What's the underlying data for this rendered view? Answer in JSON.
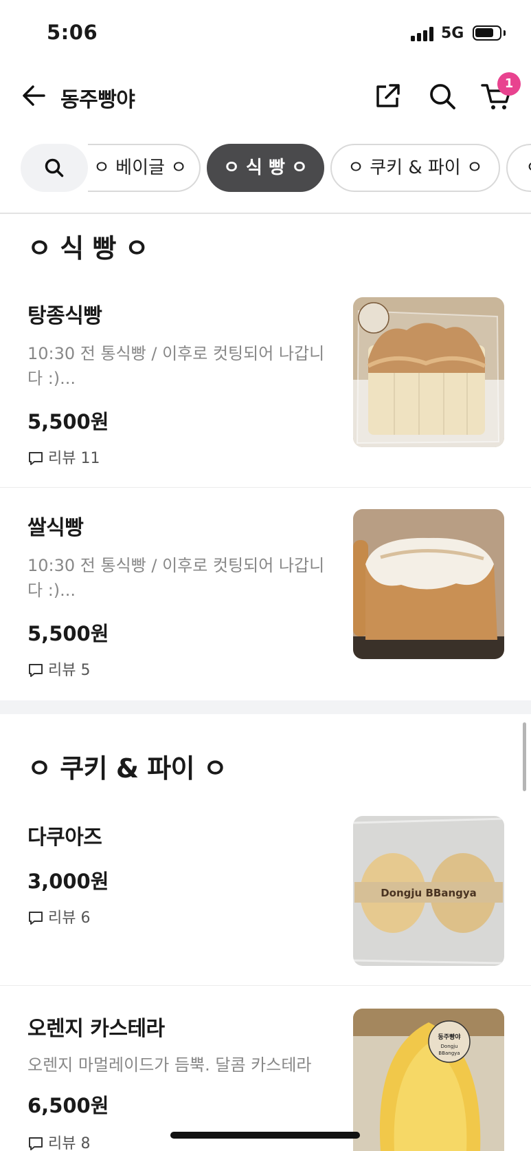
{
  "status_bar": {
    "time": "5:06",
    "network": "5G"
  },
  "header": {
    "title": "동주빵야",
    "cart_count": "1"
  },
  "chips": [
    {
      "label": "ㅇ 베이글 ㅇ"
    },
    {
      "label": "ㅇ 식 빵 ㅇ"
    },
    {
      "label": "ㅇ 쿠키 & 파이 ㅇ"
    },
    {
      "label": "ㅇ"
    }
  ],
  "sections": [
    {
      "title": "ㅇ 식 빵 ㅇ",
      "items": [
        {
          "name": "탕종식빵",
          "desc": "10:30 전 통식빵 / 이후로 컷팅되어 나갑니다 :)...",
          "price": "5,500원",
          "review": "리뷰 11"
        },
        {
          "name": "쌀식빵",
          "desc": "10:30 전 통식빵 / 이후로 컷팅되어 나갑니다 :)...",
          "price": "5,500원",
          "review": "리뷰 5"
        }
      ]
    },
    {
      "title": "ㅇ 쿠키 & 파이 ㅇ",
      "items": [
        {
          "name": "다쿠아즈",
          "desc": "",
          "price": "3,000원",
          "review": "리뷰 6",
          "image_text": "Dongju BBangya"
        },
        {
          "name": "오렌지 카스테라",
          "desc": "오렌지 마멀레이드가 듬뿍. 달콤 카스테라",
          "price": "6,500원",
          "review": "리뷰 8",
          "image_text": "동주빵야 Dongju BBangya"
        }
      ]
    }
  ],
  "colors": {
    "accent_badge": "#e8438f",
    "active_chip": "#4a4a4c",
    "muted_text": "#888888"
  },
  "icons": [
    "back-arrow-icon",
    "share-icon",
    "search-icon",
    "cart-icon",
    "review-bubble-icon"
  ]
}
